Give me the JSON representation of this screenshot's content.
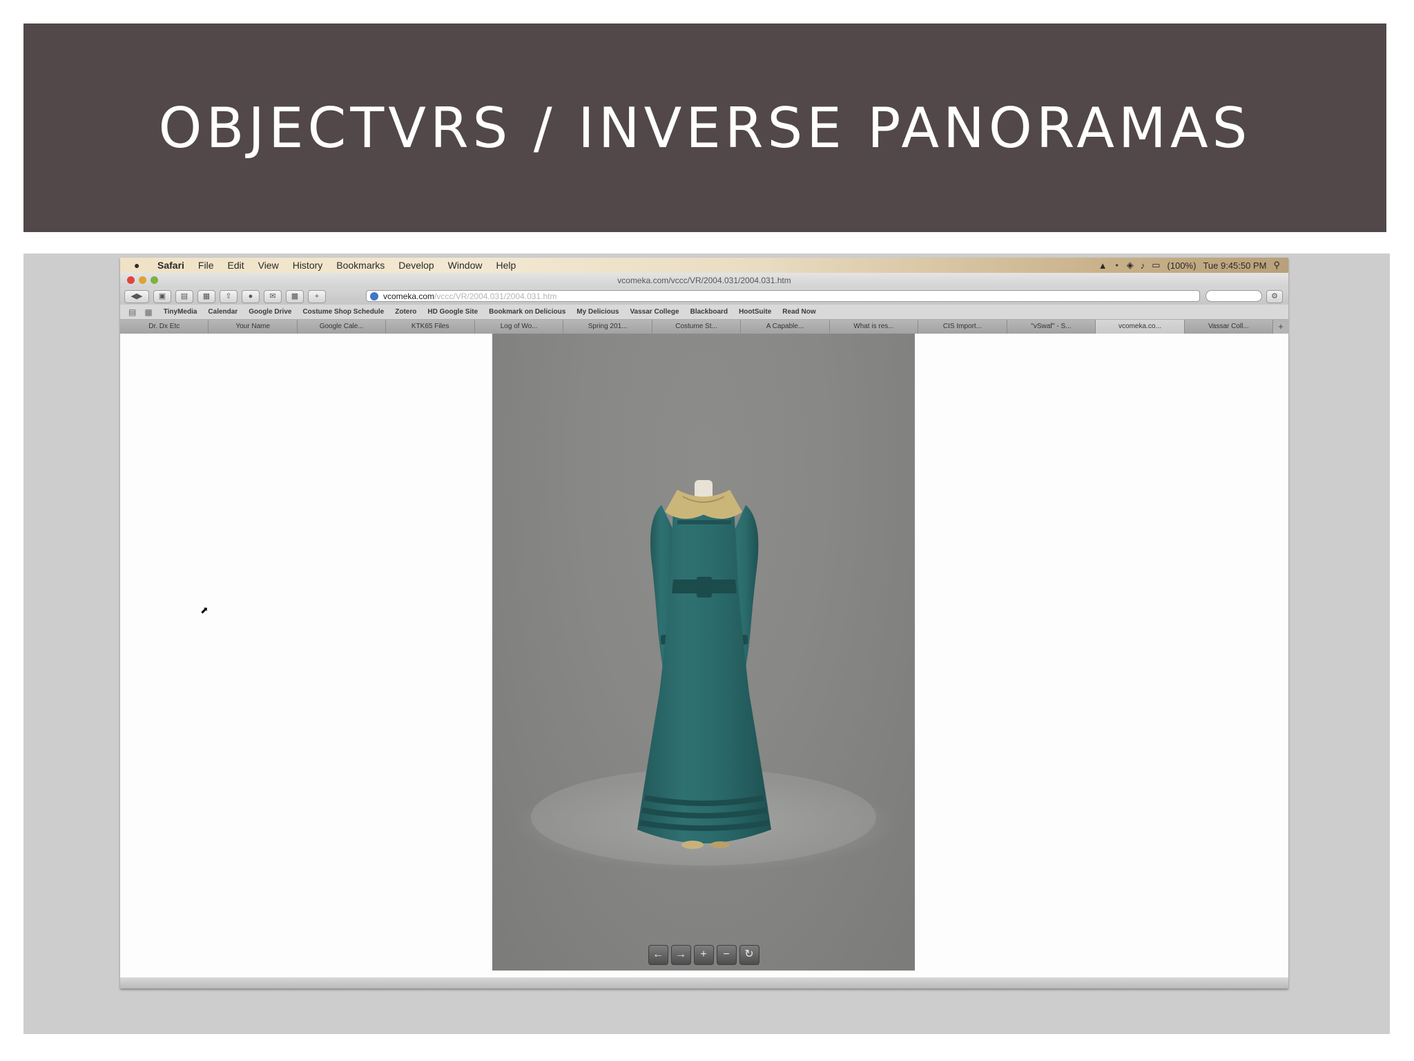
{
  "slide": {
    "title": "OBJECTVRS / INVERSE PANORAMAS"
  },
  "mac_menubar": {
    "app": "Safari",
    "items": [
      "File",
      "Edit",
      "View",
      "History",
      "Bookmarks",
      "Develop",
      "Window",
      "Help"
    ],
    "battery": "(100%)",
    "clock": "Tue 9:45:50 PM"
  },
  "browser": {
    "window_title": "vcomeka.com/vccc/VR/2004.031/2004.031.htm",
    "url_host": "vcomeka.com",
    "url_path": "/vccc/VR/2004.031/2004.031.htm",
    "bookmarks": [
      "TinyMedia",
      "Calendar",
      "Google Drive",
      "Costume Shop Schedule",
      "Zotero",
      "HD Google Site",
      "Bookmark on Delicious",
      "My Delicious",
      "Vassar College",
      "Blackboard",
      "HootSuite",
      "Read Now"
    ],
    "tabs": [
      "Dr. Dx Etc",
      "Your Name",
      "Google Cale...",
      "KTK65 Files",
      "Log of Wo...",
      "Spring 201...",
      "Costume St...",
      "A Capable...",
      "What is res...",
      "CIS Import...",
      "\"vSwaf\" - S...",
      "vcomeka.co...",
      "Vassar Coll..."
    ],
    "active_tab_index": 11
  },
  "viewer": {
    "controls": [
      "left-arrow",
      "right-arrow",
      "zoom-in",
      "zoom-out",
      "reset"
    ]
  },
  "colors": {
    "title_band": "#524849",
    "panel": "#cecdcd",
    "dress": "#2d6b6c",
    "collar": "#cbb67a"
  }
}
